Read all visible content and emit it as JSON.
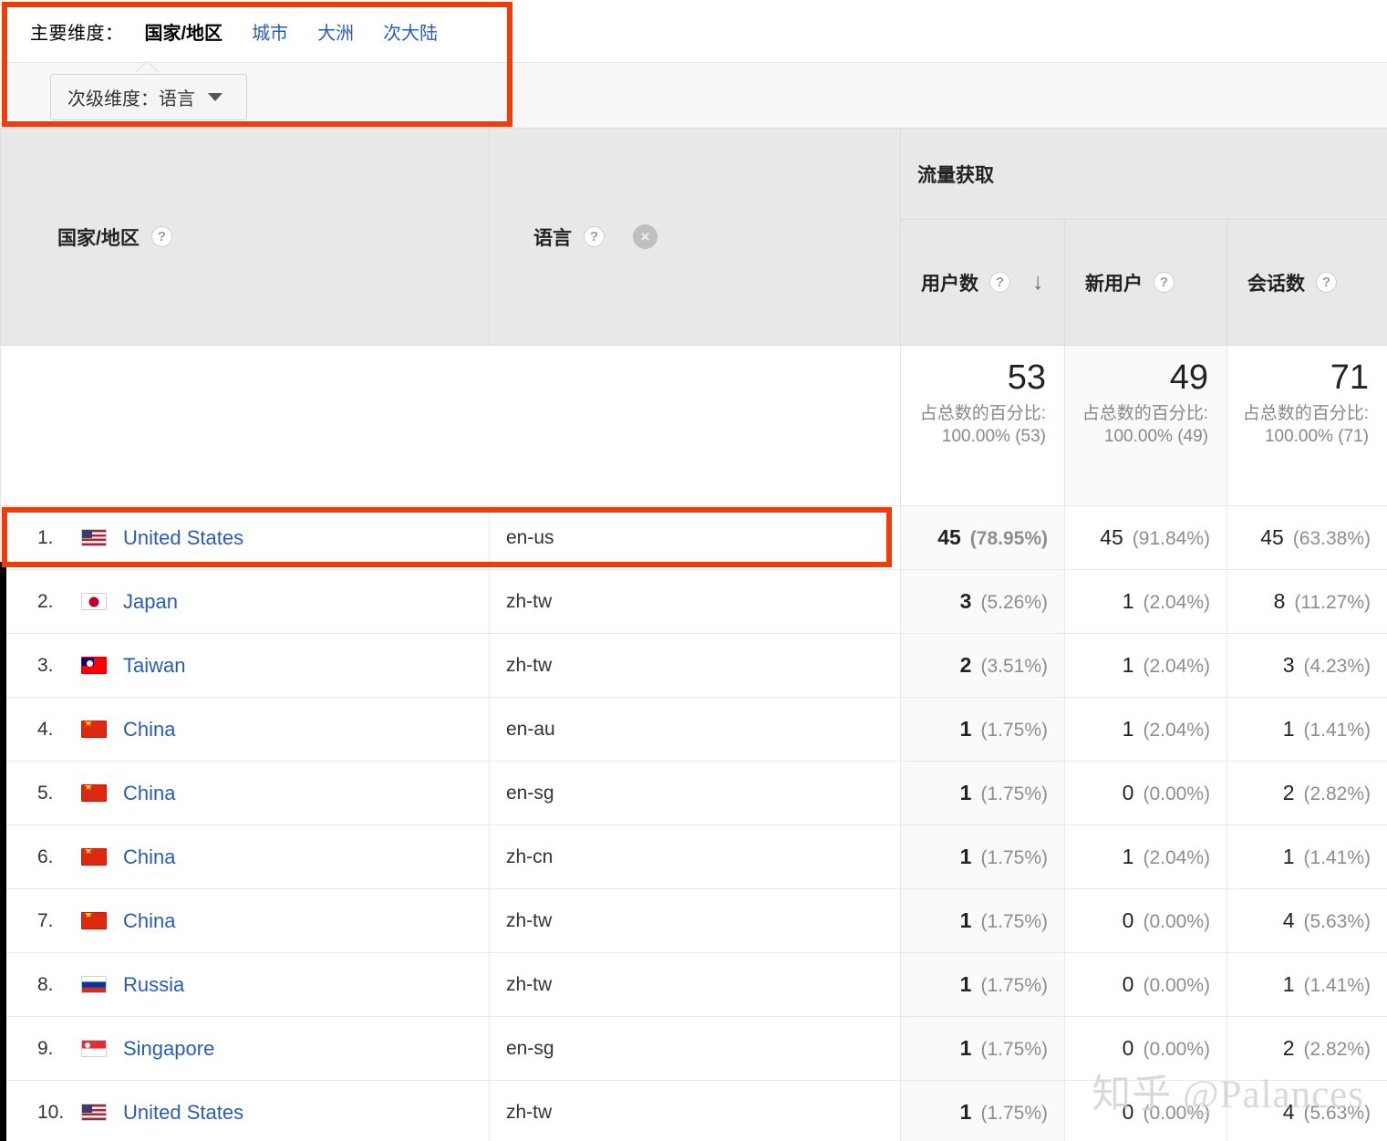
{
  "dimension_bar": {
    "primary_label": "主要维度：",
    "tabs": [
      {
        "label": "国家/地区",
        "active": true
      },
      {
        "label": "城市",
        "active": false
      },
      {
        "label": "大洲",
        "active": false
      },
      {
        "label": "次大陆",
        "active": false
      }
    ],
    "secondary_dimension_button": {
      "label": "次级维度：语言",
      "arrow_icon": "chevron-down-icon"
    }
  },
  "table": {
    "group_header": "流量获取",
    "dimension_columns": [
      {
        "label": "国家/地区",
        "help_icon": "help-icon",
        "removable": false
      },
      {
        "label": "语言",
        "help_icon": "help-icon",
        "removable": true,
        "close_icon": "close-circle-icon"
      }
    ],
    "metric_columns": [
      {
        "label": "用户数",
        "help_icon": "help-icon",
        "sorted": true,
        "sort_icon": "arrow-down-icon"
      },
      {
        "label": "新用户",
        "help_icon": "help-icon",
        "sorted": false
      },
      {
        "label": "会话数",
        "help_icon": "help-icon",
        "sorted": false
      }
    ],
    "totals": [
      {
        "value": "53",
        "subtitle": "占总数的百分比: 100.00% (53)"
      },
      {
        "value": "49",
        "subtitle": "占总数的百分比: 100.00% (49)"
      },
      {
        "value": "71",
        "subtitle": "占总数的百分比: 100.00% (71)"
      }
    ],
    "rows": [
      {
        "rank": "1.",
        "flag": "flag-us",
        "country": "United States",
        "language": "en-us",
        "users": "45",
        "users_pct": "(78.95%)",
        "new_users": "45",
        "new_users_pct": "(91.84%)",
        "sessions": "45",
        "sessions_pct": "(63.38%)",
        "highlighted": true
      },
      {
        "rank": "2.",
        "flag": "flag-jp",
        "country": "Japan",
        "language": "zh-tw",
        "users": "3",
        "users_pct": "(5.26%)",
        "new_users": "1",
        "new_users_pct": "(2.04%)",
        "sessions": "8",
        "sessions_pct": "(11.27%)",
        "highlighted": false
      },
      {
        "rank": "3.",
        "flag": "flag-tw",
        "country": "Taiwan",
        "language": "zh-tw",
        "users": "2",
        "users_pct": "(3.51%)",
        "new_users": "1",
        "new_users_pct": "(2.04%)",
        "sessions": "3",
        "sessions_pct": "(4.23%)",
        "highlighted": false
      },
      {
        "rank": "4.",
        "flag": "flag-cn",
        "country": "China",
        "language": "en-au",
        "users": "1",
        "users_pct": "(1.75%)",
        "new_users": "1",
        "new_users_pct": "(2.04%)",
        "sessions": "1",
        "sessions_pct": "(1.41%)",
        "highlighted": false
      },
      {
        "rank": "5.",
        "flag": "flag-cn",
        "country": "China",
        "language": "en-sg",
        "users": "1",
        "users_pct": "(1.75%)",
        "new_users": "0",
        "new_users_pct": "(0.00%)",
        "sessions": "2",
        "sessions_pct": "(2.82%)",
        "highlighted": false
      },
      {
        "rank": "6.",
        "flag": "flag-cn",
        "country": "China",
        "language": "zh-cn",
        "users": "1",
        "users_pct": "(1.75%)",
        "new_users": "1",
        "new_users_pct": "(2.04%)",
        "sessions": "1",
        "sessions_pct": "(1.41%)",
        "highlighted": false
      },
      {
        "rank": "7.",
        "flag": "flag-cn",
        "country": "China",
        "language": "zh-tw",
        "users": "1",
        "users_pct": "(1.75%)",
        "new_users": "0",
        "new_users_pct": "(0.00%)",
        "sessions": "4",
        "sessions_pct": "(5.63%)",
        "highlighted": false
      },
      {
        "rank": "8.",
        "flag": "flag-ru",
        "country": "Russia",
        "language": "zh-tw",
        "users": "1",
        "users_pct": "(1.75%)",
        "new_users": "0",
        "new_users_pct": "(0.00%)",
        "sessions": "1",
        "sessions_pct": "(1.41%)",
        "highlighted": false
      },
      {
        "rank": "9.",
        "flag": "flag-sg",
        "country": "Singapore",
        "language": "en-sg",
        "users": "1",
        "users_pct": "(1.75%)",
        "new_users": "0",
        "new_users_pct": "(0.00%)",
        "sessions": "2",
        "sessions_pct": "(2.82%)",
        "highlighted": false
      },
      {
        "rank": "10.",
        "flag": "flag-us",
        "country": "United States",
        "language": "zh-tw",
        "users": "1",
        "users_pct": "(1.75%)",
        "new_users": "0",
        "new_users_pct": "(0.00%)",
        "sessions": "4",
        "sessions_pct": "(5.63%)",
        "highlighted": false
      }
    ]
  },
  "annotations": {
    "color": "#ee3c0a",
    "boxes": [
      "dimension-bar-highlight",
      "first-row-highlight"
    ]
  },
  "watermark": "知乎 @Palances"
}
